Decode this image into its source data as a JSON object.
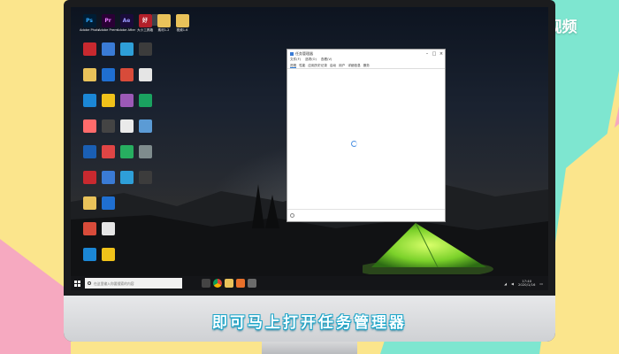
{
  "watermark": {
    "text": "天奇·视频"
  },
  "caption": {
    "text": "即可马上打开任务管理器"
  },
  "desktop": {
    "icons": [
      {
        "label": "Ps",
        "name": "photoshop-icon",
        "color": "#001d34",
        "fg": "#31a8ff"
      },
      {
        "label": "Pr",
        "name": "premiere-icon",
        "color": "#2a0035",
        "fg": "#e77cff"
      },
      {
        "label": "Ae",
        "name": "after-effects-icon",
        "color": "#1a0b3a",
        "fg": "#9999ff"
      },
      {
        "label": "好",
        "name": "haozhuo-icon",
        "color": "#b2202a",
        "fg": "#ffffff"
      },
      {
        "label": "",
        "name": "folder-icon",
        "color": "#e9c25a",
        "fg": "#ffffff"
      },
      {
        "label": "",
        "name": "folder-icon-2",
        "color": "#e9c25a",
        "fg": "#ffffff"
      }
    ],
    "icon_labels": [
      "Adobe Photosh...",
      "Adobe Premiere Pr...",
      "Adobe After Effects CC",
      "大小工具箱",
      "素材1.2",
      "视频1.6"
    ]
  },
  "task_manager": {
    "title": "任务管理器",
    "menu": [
      "文件(F)",
      "选项(O)",
      "查看(V)"
    ],
    "tabs": [
      "进程",
      "性能",
      "应用历史记录",
      "启动",
      "用户",
      "详细信息",
      "服务"
    ]
  },
  "taskbar": {
    "search_placeholder": "在这里输入你要搜索的内容",
    "time": "17:40",
    "date": "2020/1/16"
  }
}
